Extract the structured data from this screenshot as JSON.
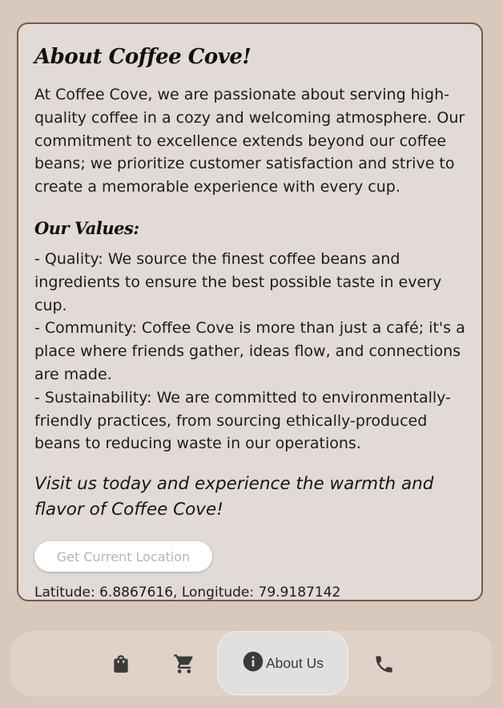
{
  "about": {
    "title": "About Coffee Cove!",
    "intro": "At Coffee Cove, we are passionate about serving high-quality coffee in a cozy and welcoming atmosphere. Our commitment to excellence extends beyond our coffee beans; we prioritize customer satisfaction and strive to create a memorable experience with every cup.",
    "values_title": "Our Values:",
    "values": [
      "- Quality: We source the finest coffee beans and ingredients to ensure the best possible taste in every cup.",
      "- Community: Coffee Cove is more than just a café; it's a place where friends gather, ideas flow, and connections are made.",
      "- Sustainability: We are committed to environmentally-friendly practices, from sourcing ethically-produced beans to reducing waste in our operations."
    ],
    "closing": "Visit us today and experience the warmth and flavor of Coffee Cove!",
    "location_button": "Get Current Location",
    "coordinates": "Latitude: 6.8867616, Longitude: 79.9187142"
  },
  "nav": {
    "items": [
      {
        "icon": "shopping-bag-icon",
        "label": ""
      },
      {
        "icon": "cart-icon",
        "label": ""
      },
      {
        "icon": "info-icon",
        "label": "About Us",
        "active": true
      },
      {
        "icon": "phone-icon",
        "label": ""
      }
    ]
  },
  "colors": {
    "background": "#d8c9bc",
    "card": "#e1dad6",
    "card_border": "#7a5848",
    "navbar": "#e0d2c8"
  }
}
